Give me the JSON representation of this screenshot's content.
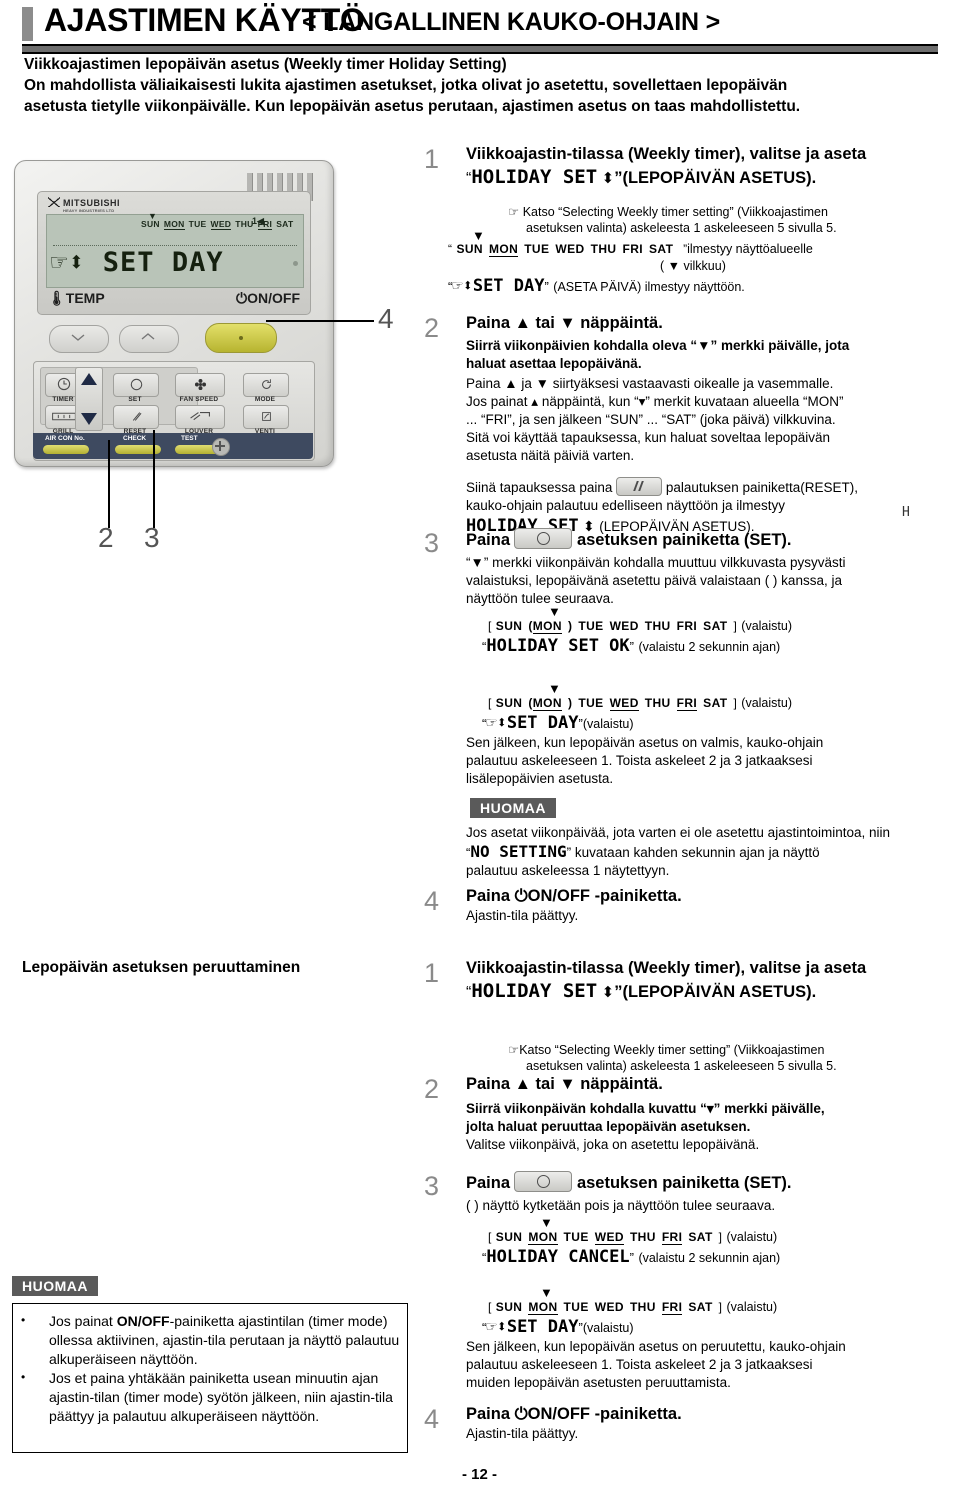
{
  "header": {
    "title": "AJASTIMEN KÄYTTÖ",
    "subtitle": "< LANGALLINEN KAUKO-OHJAIN >"
  },
  "intro": {
    "line1": "Viikkoajastimen lepopäivän asetus (Weekly timer Holiday Setting)",
    "line2": "On mahdollista väliaikaisesti lukita ajastimen asetukset, jotka olivat jo asetettu, sovellettaen lepopäivän",
    "line3": "asetusta tietylle viikonpäivälle. Kun lepopäivän asetus perutaan, ajastimen asetus on taas mahdollistettu."
  },
  "remote": {
    "brand_name": "MITSUBISHI",
    "brand_sub": "HEAVY INDUSTRIES LTD",
    "lcd": {
      "days": [
        "SUN",
        "MON",
        "TUE",
        "WED",
        "THU",
        "FRI",
        "SAT"
      ],
      "underlined": [
        "MON",
        "WED",
        "FRI"
      ],
      "marker_day": "MON",
      "number": "1",
      "main_text": "SET DAY",
      "temp_label": "TEMP",
      "onoff_label": "ON/OFF"
    },
    "buttons": {
      "timer": "TIMER",
      "grill": "GRILL",
      "set": "SET",
      "reset": "RESET",
      "fan_speed": "FAN SPEED",
      "louver": "LOUVER",
      "mode": "MODE",
      "venti": "VENTI",
      "air_con_no": "AIR CON No.",
      "check": "CHECK",
      "test": "TEST"
    },
    "callouts": [
      "4",
      "2",
      "3"
    ]
  },
  "section1": {
    "steps": [
      {
        "num": "1",
        "head_line1": "Viikkoajastin-tilassa (Weekly timer), valitse ja aseta",
        "head_lcd": "HOLIDAY SET",
        "head_line2": "”(LEPOPÄIVÄN ASETUS).",
        "quote_open": "“",
        "ref_line1": "Katso “Selecting Weekly timer setting” (Viikkoajastimen",
        "ref_line2": "asetuksen valinta) askeleesta 1 askeleeseen 5 sivulla 5.",
        "days_note_after": "ilmestyy näyttöalueelle",
        "blink_note": "( ▼ vilkkuu)",
        "setday_lcd": "SET DAY",
        "setday_note": "(ASETA PÄIVÄ) ilmestyy näyttöön."
      },
      {
        "num": "2",
        "head": "Paina ▲ tai ▼ näppäintä.",
        "bold_line1": "Siirrä viikonpäivien kohdalla oleva “▼” merkki päivälle, jota",
        "bold_line2": "haluat asettaa lepopäivänä.",
        "line1": "Paina ▲ ja ▼ siirtyäksesi vastaavasti oikealle ja vasemmalle.",
        "line2": "Jos painat ▴ näppäintä, kun “▾” merkit kuvataan alueella “MON”",
        "line3": "... “FRI”, ja sen jälkeen “SUN” ... “SAT” (joka päivä) vilkkuvina.",
        "line4": "Sitä voi käyttää tapauksessa, kun haluat soveltaa lepopäivän",
        "line5": "asetusta näitä päiviä varten.",
        "reset_line1a": "Siinä tapauksessa paina",
        "reset_line1b": "palautuksen painiketta(RESET),",
        "reset_line2": "kauko-ohjain palautuu edelliseen näyttöön ja ilmestyy",
        "reset_lcd": "HOLIDAY SET",
        "reset_line3": "(LEPOPÄIVÄN ASETUS)."
      },
      {
        "num": "3",
        "head_a": "Paina",
        "head_b": "asetuksen painiketta (SET).",
        "line1": "“▼” merkki viikonpäivän kohdalla muuttuu vilkkuvasta pysyvästi",
        "line2": "valaistuksi, lepopäivänä asetettu päivä valaistaan ( ) kanssa, ja",
        "line3": "näyttöön tulee seuraava."
      },
      {
        "num": "4",
        "head": "Paina ⏻ON/OFF -painiketta.",
        "line1": "Ajastin-tila päättyy."
      }
    ],
    "display_examples": [
      {
        "days": [
          "SUN",
          "MON",
          "TUE",
          "WED",
          "THU",
          "FRI",
          "SAT"
        ],
        "paren_day": "MON",
        "underlined": [],
        "marker_day": "MON",
        "bracket_open": "[",
        "bracket_close": "]",
        "suffix": "(valaistu)",
        "lcd_text": "HOLIDAY SET OK",
        "lcd_suffix": "(valaistu 2 sekunnin ajan)"
      },
      {
        "days": [
          "SUN",
          "MON",
          "TUE",
          "WED",
          "THU",
          "FRI",
          "SAT"
        ],
        "paren_day": "MON",
        "underlined": [
          "MON",
          "WED",
          "FRI"
        ],
        "marker_day": "MON",
        "bracket_open": "[",
        "bracket_close": "]",
        "suffix": "(valaistu)",
        "lcd_text": "SET DAY",
        "lcd_suffix": "(valaistu)"
      }
    ],
    "after_example_line1": "Sen jälkeen, kun lepopäivän asetus on valmis, kauko-ohjain",
    "after_example_line2": "palautuu askeleeseen 1. Toista askeleet 2 ja 3 jatkaaksesi",
    "after_example_line3": "lisälepopäivien asetusta.",
    "huomaa": {
      "tag": "HUOMAA",
      "line1": "Jos asetat viikonpäivää, jota varten ei ole asetettu ajastintoimintoa, niin",
      "lcd": "NO SETTING",
      "line2": "” kuvataan kahden sekunnin ajan ja näyttö",
      "line3": "palautuu askeleessa 1 näytettyyn.",
      "quote_open": "“"
    }
  },
  "section2": {
    "title": "Lepopäivän asetuksen peruuttaminen",
    "steps": [
      {
        "num": "1",
        "head_line1": "Viikkoajastin-tilassa (Weekly timer), valitse ja aseta",
        "head_lcd": "HOLIDAY SET",
        "head_line2": "”(LEPOPÄIVÄN ASETUS).",
        "quote_open": "“",
        "ref_line1": "Katso “Selecting Weekly timer setting” (Viikkoajastimen",
        "ref_line2": "asetuksen valinta) askeleesta 1 askeleeseen 5 sivulla 5."
      },
      {
        "num": "2",
        "head": "Paina ▲ tai ▼ näppäintä.",
        "bold_line1": "Siirrä viikonpäivän kohdalla kuvattu “▾” merkki päivälle,",
        "bold_line2": "jolta haluat  peruuttaa lepopäivän asetuksen.",
        "line1": "Valitse viikonpäivä, joka on asetettu lepopäivänä."
      },
      {
        "num": "3",
        "head_a": "Paina",
        "head_b": "asetuksen painiketta (SET).",
        "line1": "( ) näyttö kytketään pois ja näyttöön tulee seuraava."
      },
      {
        "num": "4",
        "head": "Paina ⏻ON/OFF -painiketta.",
        "line1": "Ajastin-tila päättyy."
      }
    ],
    "display_examples": [
      {
        "days": [
          "SUN",
          "MON",
          "TUE",
          "WED",
          "THU",
          "FRI",
          "SAT"
        ],
        "paren_day": "",
        "underlined": [
          "MON",
          "WED",
          "FRI"
        ],
        "marker_day": "MON",
        "bracket_open": "[",
        "bracket_close": "]",
        "suffix": "(valaistu)",
        "lcd_text": "HOLIDAY CANCEL",
        "lcd_suffix": "(valaistu 2 sekunnin ajan)"
      },
      {
        "days": [
          "SUN",
          "MON",
          "TUE",
          "WED",
          "THU",
          "FRI",
          "SAT"
        ],
        "paren_day": "",
        "underlined": [
          "MON",
          "FRI"
        ],
        "marker_day": "MON",
        "bracket_open": "[",
        "bracket_close": "]",
        "suffix": "(valaistu)",
        "lcd_text": "SET DAY",
        "lcd_suffix": "(valaistu)"
      }
    ],
    "after_example_line1": "Sen jälkeen, kun lepopäivän asetus on peruutettu, kauko-ohjain",
    "after_example_line2": "palautuu askeleeseen 1. Toista askeleet 2 ja 3 jatkaaksesi",
    "after_example_line3": "muiden lepopäivän asetusten peruuttamista."
  },
  "bottom_note": {
    "tag": "HUOMAA",
    "bullets": [
      "Jos painat ON/OFF-painiketta ajastintilan (timer mode) ollessa aktiivinen, ajastin-tila perutaan ja näyttö palautuu alkuperäiseen näyttöön.",
      "Jos et paina yhtäkään painiketta usean minuutin ajan ajastin-tilan (timer mode) syötön jälkeen, niin ajastin-tila päättyy ja palautuu alkuperäiseen näyttöön."
    ],
    "bullet1_bold": "ON/OFF"
  },
  "stray_mark": "H",
  "page_number": "- 12 -"
}
